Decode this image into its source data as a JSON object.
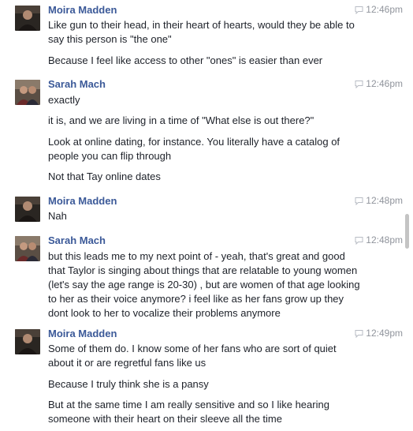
{
  "messages": [
    {
      "sender": "Moira Madden",
      "time": "12:46pm",
      "lines": [
        "Like gun to their head, in their heart of hearts, would they be able to say this person is \"the one\"",
        "Because I feel like access to other \"ones\" is easier than ever"
      ]
    },
    {
      "sender": "Sarah Mach",
      "time": "12:46pm",
      "lines": [
        "exactly",
        "it is, and we are living in a time of \"What else is out there?\"",
        "Look at online dating, for instance. You literally have a catalog of people you can flip through",
        "Not that Tay online dates"
      ]
    },
    {
      "sender": "Moira Madden",
      "time": "12:48pm",
      "lines": [
        "Nah"
      ]
    },
    {
      "sender": "Sarah Mach",
      "time": "12:48pm",
      "lines": [
        "but this leads me to my next point of - yeah, that's great and good that Taylor is singing about things that are relatable to young women (let's say the age range is 20-30) , but are women of that age looking to her as their voice anymore? i feel like as her fans grow up they dont look to her to vocalize their problems anymore"
      ]
    },
    {
      "sender": "Moira Madden",
      "time": "12:49pm",
      "lines": [
        "Some of them do. I know some of her fans who are sort of quiet about it or are regretful fans like us",
        "Because I truly think she is a pansy",
        "But at the same time I am really sensitive and so I like hearing someone with their heart on their sleeve all the time"
      ]
    }
  ],
  "icons": {
    "timestamp": "chat-bubble-icon",
    "avatar": "profile-photo"
  },
  "colors": {
    "sender": "#3b5998",
    "time": "#90949c",
    "text": "#1d2129"
  }
}
